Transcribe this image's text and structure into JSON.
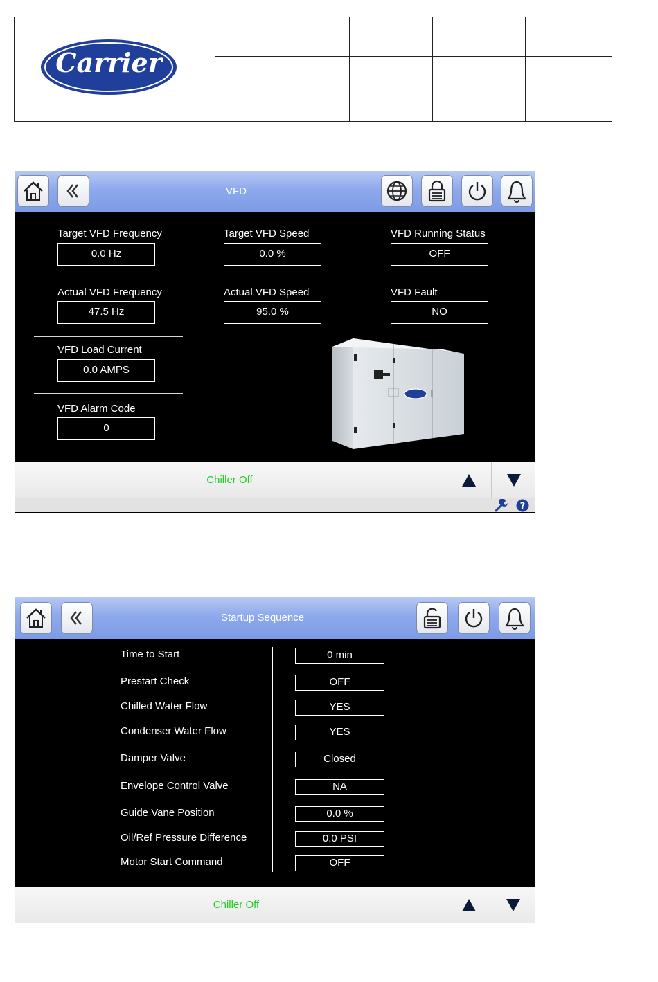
{
  "logo": {
    "text": "Carrier"
  },
  "screen1": {
    "title": "VFD",
    "icons": [
      "home-icon",
      "back-icon",
      "globe-icon",
      "lock-icon",
      "power-icon",
      "bell-icon"
    ],
    "fields": {
      "target_freq": {
        "label": "Target VFD Frequency",
        "value": "0.0 Hz"
      },
      "target_speed": {
        "label": "Target VFD Speed",
        "value": "0.0 %"
      },
      "running_status": {
        "label": "VFD Running Status",
        "value": "OFF"
      },
      "actual_freq": {
        "label": "Actual VFD Frequency",
        "value": "47.5 Hz"
      },
      "actual_speed": {
        "label": "Actual VFD Speed",
        "value": "95.0 %"
      },
      "fault": {
        "label": "VFD Fault",
        "value": "NO"
      },
      "load_current": {
        "label": "VFD Load Current",
        "value": "0.0 AMPS"
      },
      "alarm_code": {
        "label": "VFD Alarm Code",
        "value": "0"
      }
    },
    "status": "Chiller Off"
  },
  "screen2": {
    "title": "Startup Sequence",
    "icons": [
      "home-icon",
      "back-icon",
      "unlock-icon",
      "power-icon",
      "bell-icon"
    ],
    "rows": [
      {
        "label": "Time to Start",
        "value": "0 min"
      },
      {
        "label": "Prestart Check",
        "value": "OFF"
      },
      {
        "label": "Chilled Water Flow",
        "value": "YES"
      },
      {
        "label": "Condenser Water Flow",
        "value": "YES"
      },
      {
        "label": "Damper Valve",
        "value": "Closed"
      },
      {
        "label": "Envelope Control Valve",
        "value": "NA"
      },
      {
        "label": "Guide Vane Position",
        "value": "0.0 %"
      },
      {
        "label": "Oil/Ref Pressure Difference",
        "value": "0.0 PSI"
      },
      {
        "label": "Motor Start Command",
        "value": "OFF"
      }
    ],
    "status": "Chiller Off"
  },
  "colors": {
    "status_green": "#22cc22",
    "titlebar_blue": "#8ea9ec",
    "logo_blue": "#1f3f9a"
  }
}
